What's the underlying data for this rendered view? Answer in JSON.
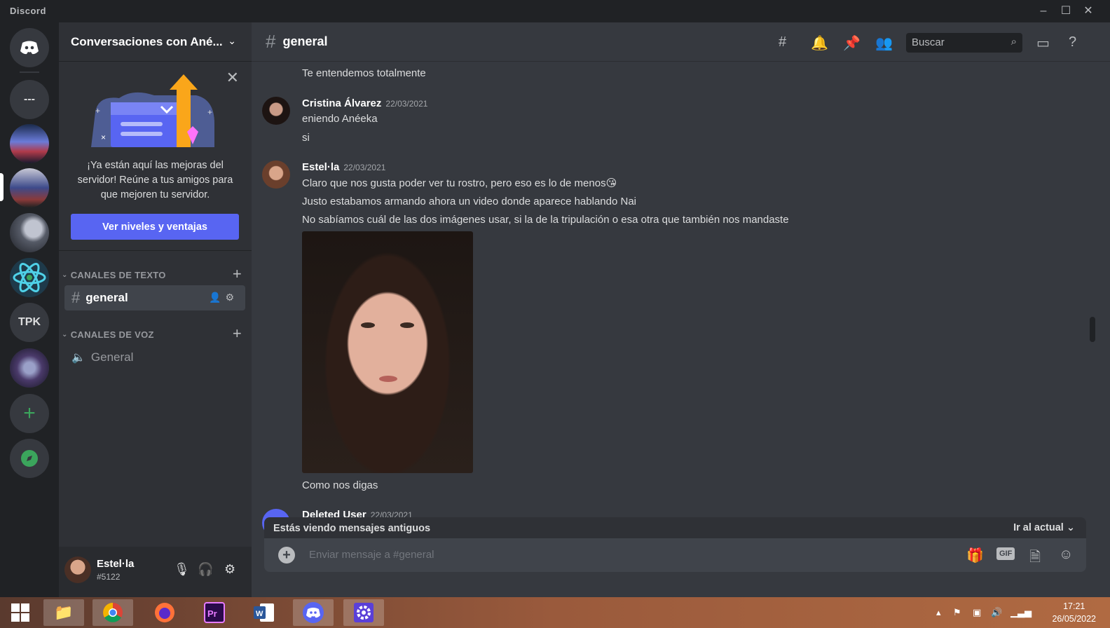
{
  "window": {
    "app_name": "Discord",
    "minimize": "–",
    "maximize": "☐",
    "close": "✕"
  },
  "rail": {
    "servers": [
      {
        "name": "home",
        "label": ""
      },
      {
        "name": "dash-server",
        "label": "---"
      },
      {
        "name": "server-3",
        "label": ""
      },
      {
        "name": "server-4",
        "label": ""
      },
      {
        "name": "server-5",
        "label": ""
      },
      {
        "name": "server-6",
        "label": ""
      },
      {
        "name": "server-tpk",
        "label": "TPK"
      },
      {
        "name": "server-8",
        "label": ""
      }
    ],
    "add_label": "+",
    "explore_label": "🧭"
  },
  "sidebar": {
    "server_name": "Conversaciones con Ané...",
    "boost": {
      "text": "¡Ya están aquí las mejoras del servidor! Reúne a tus amigos para que mejoren tu servidor.",
      "button": "Ver niveles y ventajas"
    },
    "text_category": "CANALES DE TEXTO",
    "voice_category": "CANALES DE VOZ",
    "text_channels": [
      {
        "name": "general"
      }
    ],
    "voice_channels": [
      {
        "name": "General"
      }
    ],
    "user": {
      "name": "Estel·la",
      "tag": "#5122"
    }
  },
  "main": {
    "channel": "general",
    "search_placeholder": "Buscar",
    "messages": [
      {
        "text": "Te entendemos totalmente"
      },
      {
        "author": "Cristina Álvarez",
        "time": "22/03/2021",
        "lines": [
          "eniendo Anéeka",
          "si"
        ]
      },
      {
        "author": "Estel·la",
        "time": "22/03/2021",
        "lines": [
          "Claro que nos gusta poder ver tu rostro, pero eso es lo de menos😘",
          "Justo estabamos armando ahora un video donde aparece hablando Nai",
          "No sabíamos cuál de las dos imágenes usar, si la de la tripulación o esa otra que también nos mandaste"
        ],
        "after_image": "Como nos digas"
      },
      {
        "author": "Deleted User",
        "time": "22/03/2021"
      }
    ],
    "old_messages_banner": "Estás viendo mensajes antiguos",
    "jump_label": "Ir al actual",
    "composer_placeholder": "Enviar mensaje a #general",
    "gif_label": "GIF"
  },
  "taskbar": {
    "apps": [
      "windows-start",
      "file-explorer",
      "chrome",
      "firefox",
      "premiere",
      "word",
      "discord",
      "settings"
    ],
    "time": "17:21",
    "date": "26/05/2022"
  },
  "colors": {
    "accent": "#5865f2",
    "bg": "#36393f",
    "sidebar": "#2f3136",
    "rail": "#202225"
  }
}
